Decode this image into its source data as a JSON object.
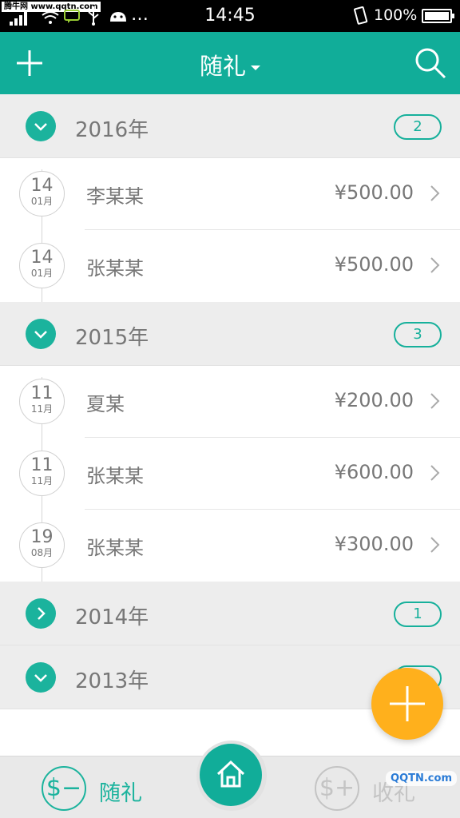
{
  "watermark_top": "腾牛网 www.qqtn.com",
  "watermark_bottom": "QQTN.com",
  "status_bar": {
    "time": "14:45",
    "battery": "100%"
  },
  "header": {
    "title": "随礼"
  },
  "groups": [
    {
      "year": "2016年",
      "count": "2",
      "expanded": true,
      "records": [
        {
          "day": "14",
          "month": "01月",
          "name": "李某某",
          "amount": "¥500.00"
        },
        {
          "day": "14",
          "month": "01月",
          "name": "张某某",
          "amount": "¥500.00"
        }
      ]
    },
    {
      "year": "2015年",
      "count": "3",
      "expanded": true,
      "records": [
        {
          "day": "11",
          "month": "11月",
          "name": "夏某",
          "amount": "¥200.00"
        },
        {
          "day": "11",
          "month": "11月",
          "name": "张某某",
          "amount": "¥600.00"
        },
        {
          "day": "19",
          "month": "08月",
          "name": "张某某",
          "amount": "¥300.00"
        }
      ]
    },
    {
      "year": "2014年",
      "count": "1",
      "expanded": false,
      "records": []
    },
    {
      "year": "2013年",
      "count": "",
      "expanded": true,
      "records": []
    }
  ],
  "bottom_nav": {
    "give_label": "随礼",
    "receive_label": "收礼"
  },
  "colors": {
    "accent": "#11ad99",
    "fab": "#ffb01c"
  }
}
